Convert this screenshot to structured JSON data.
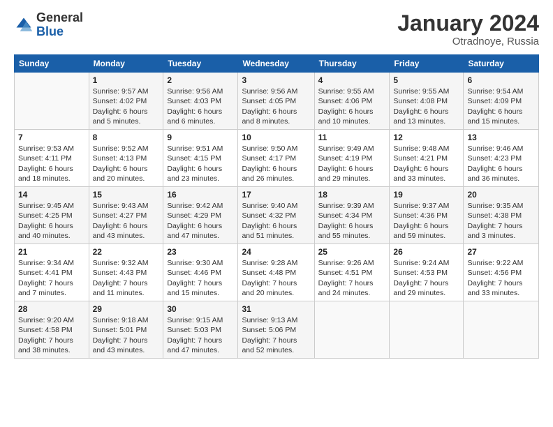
{
  "header": {
    "logo_general": "General",
    "logo_blue": "Blue",
    "month_title": "January 2024",
    "location": "Otradnoye, Russia"
  },
  "days_of_week": [
    "Sunday",
    "Monday",
    "Tuesday",
    "Wednesday",
    "Thursday",
    "Friday",
    "Saturday"
  ],
  "weeks": [
    [
      {
        "day": "",
        "sunrise": "",
        "sunset": "",
        "daylight": ""
      },
      {
        "day": "1",
        "sunrise": "Sunrise: 9:57 AM",
        "sunset": "Sunset: 4:02 PM",
        "daylight": "Daylight: 6 hours and 5 minutes."
      },
      {
        "day": "2",
        "sunrise": "Sunrise: 9:56 AM",
        "sunset": "Sunset: 4:03 PM",
        "daylight": "Daylight: 6 hours and 6 minutes."
      },
      {
        "day": "3",
        "sunrise": "Sunrise: 9:56 AM",
        "sunset": "Sunset: 4:05 PM",
        "daylight": "Daylight: 6 hours and 8 minutes."
      },
      {
        "day": "4",
        "sunrise": "Sunrise: 9:55 AM",
        "sunset": "Sunset: 4:06 PM",
        "daylight": "Daylight: 6 hours and 10 minutes."
      },
      {
        "day": "5",
        "sunrise": "Sunrise: 9:55 AM",
        "sunset": "Sunset: 4:08 PM",
        "daylight": "Daylight: 6 hours and 13 minutes."
      },
      {
        "day": "6",
        "sunrise": "Sunrise: 9:54 AM",
        "sunset": "Sunset: 4:09 PM",
        "daylight": "Daylight: 6 hours and 15 minutes."
      }
    ],
    [
      {
        "day": "7",
        "sunrise": "Sunrise: 9:53 AM",
        "sunset": "Sunset: 4:11 PM",
        "daylight": "Daylight: 6 hours and 18 minutes."
      },
      {
        "day": "8",
        "sunrise": "Sunrise: 9:52 AM",
        "sunset": "Sunset: 4:13 PM",
        "daylight": "Daylight: 6 hours and 20 minutes."
      },
      {
        "day": "9",
        "sunrise": "Sunrise: 9:51 AM",
        "sunset": "Sunset: 4:15 PM",
        "daylight": "Daylight: 6 hours and 23 minutes."
      },
      {
        "day": "10",
        "sunrise": "Sunrise: 9:50 AM",
        "sunset": "Sunset: 4:17 PM",
        "daylight": "Daylight: 6 hours and 26 minutes."
      },
      {
        "day": "11",
        "sunrise": "Sunrise: 9:49 AM",
        "sunset": "Sunset: 4:19 PM",
        "daylight": "Daylight: 6 hours and 29 minutes."
      },
      {
        "day": "12",
        "sunrise": "Sunrise: 9:48 AM",
        "sunset": "Sunset: 4:21 PM",
        "daylight": "Daylight: 6 hours and 33 minutes."
      },
      {
        "day": "13",
        "sunrise": "Sunrise: 9:46 AM",
        "sunset": "Sunset: 4:23 PM",
        "daylight": "Daylight: 6 hours and 36 minutes."
      }
    ],
    [
      {
        "day": "14",
        "sunrise": "Sunrise: 9:45 AM",
        "sunset": "Sunset: 4:25 PM",
        "daylight": "Daylight: 6 hours and 40 minutes."
      },
      {
        "day": "15",
        "sunrise": "Sunrise: 9:43 AM",
        "sunset": "Sunset: 4:27 PM",
        "daylight": "Daylight: 6 hours and 43 minutes."
      },
      {
        "day": "16",
        "sunrise": "Sunrise: 9:42 AM",
        "sunset": "Sunset: 4:29 PM",
        "daylight": "Daylight: 6 hours and 47 minutes."
      },
      {
        "day": "17",
        "sunrise": "Sunrise: 9:40 AM",
        "sunset": "Sunset: 4:32 PM",
        "daylight": "Daylight: 6 hours and 51 minutes."
      },
      {
        "day": "18",
        "sunrise": "Sunrise: 9:39 AM",
        "sunset": "Sunset: 4:34 PM",
        "daylight": "Daylight: 6 hours and 55 minutes."
      },
      {
        "day": "19",
        "sunrise": "Sunrise: 9:37 AM",
        "sunset": "Sunset: 4:36 PM",
        "daylight": "Daylight: 6 hours and 59 minutes."
      },
      {
        "day": "20",
        "sunrise": "Sunrise: 9:35 AM",
        "sunset": "Sunset: 4:38 PM",
        "daylight": "Daylight: 7 hours and 3 minutes."
      }
    ],
    [
      {
        "day": "21",
        "sunrise": "Sunrise: 9:34 AM",
        "sunset": "Sunset: 4:41 PM",
        "daylight": "Daylight: 7 hours and 7 minutes."
      },
      {
        "day": "22",
        "sunrise": "Sunrise: 9:32 AM",
        "sunset": "Sunset: 4:43 PM",
        "daylight": "Daylight: 7 hours and 11 minutes."
      },
      {
        "day": "23",
        "sunrise": "Sunrise: 9:30 AM",
        "sunset": "Sunset: 4:46 PM",
        "daylight": "Daylight: 7 hours and 15 minutes."
      },
      {
        "day": "24",
        "sunrise": "Sunrise: 9:28 AM",
        "sunset": "Sunset: 4:48 PM",
        "daylight": "Daylight: 7 hours and 20 minutes."
      },
      {
        "day": "25",
        "sunrise": "Sunrise: 9:26 AM",
        "sunset": "Sunset: 4:51 PM",
        "daylight": "Daylight: 7 hours and 24 minutes."
      },
      {
        "day": "26",
        "sunrise": "Sunrise: 9:24 AM",
        "sunset": "Sunset: 4:53 PM",
        "daylight": "Daylight: 7 hours and 29 minutes."
      },
      {
        "day": "27",
        "sunrise": "Sunrise: 9:22 AM",
        "sunset": "Sunset: 4:56 PM",
        "daylight": "Daylight: 7 hours and 33 minutes."
      }
    ],
    [
      {
        "day": "28",
        "sunrise": "Sunrise: 9:20 AM",
        "sunset": "Sunset: 4:58 PM",
        "daylight": "Daylight: 7 hours and 38 minutes."
      },
      {
        "day": "29",
        "sunrise": "Sunrise: 9:18 AM",
        "sunset": "Sunset: 5:01 PM",
        "daylight": "Daylight: 7 hours and 43 minutes."
      },
      {
        "day": "30",
        "sunrise": "Sunrise: 9:15 AM",
        "sunset": "Sunset: 5:03 PM",
        "daylight": "Daylight: 7 hours and 47 minutes."
      },
      {
        "day": "31",
        "sunrise": "Sunrise: 9:13 AM",
        "sunset": "Sunset: 5:06 PM",
        "daylight": "Daylight: 7 hours and 52 minutes."
      },
      {
        "day": "",
        "sunrise": "",
        "sunset": "",
        "daylight": ""
      },
      {
        "day": "",
        "sunrise": "",
        "sunset": "",
        "daylight": ""
      },
      {
        "day": "",
        "sunrise": "",
        "sunset": "",
        "daylight": ""
      }
    ]
  ]
}
